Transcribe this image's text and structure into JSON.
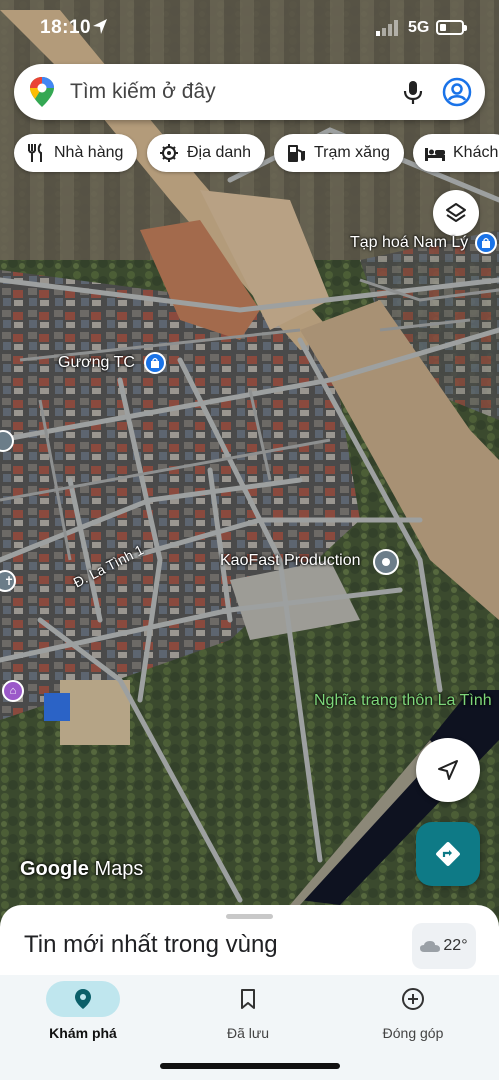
{
  "status_bar": {
    "time": "18:10",
    "network": "5G"
  },
  "search": {
    "placeholder": "Tìm kiếm ở đây"
  },
  "chips": [
    {
      "label": "Nhà hàng",
      "icon": "restaurant-icon"
    },
    {
      "label": "Địa danh",
      "icon": "landmark-icon"
    },
    {
      "label": "Trạm xăng",
      "icon": "gas-station-icon"
    },
    {
      "label": "Khách",
      "icon": "hotel-icon"
    }
  ],
  "map": {
    "places": {
      "tap_hoa": "Tạp hoá Nam Lý",
      "guong_tc": "Gương TC",
      "kaofast": "KaoFast Production",
      "nghia_trang": "Nghĩa trang thôn La Tình"
    },
    "road": "Đ. La Tình 1",
    "watermark_google": "Google",
    "watermark_maps": "Maps"
  },
  "sheet": {
    "title": "Tin mới nhất trong vùng",
    "weather": "22°"
  },
  "nav": {
    "explore": "Khám phá",
    "saved": "Đã lưu",
    "contribute": "Đóng góp"
  },
  "colors": {
    "accent": "#0e7a86",
    "active_pill": "#bfe6ee",
    "green_label": "#7ed77a"
  }
}
